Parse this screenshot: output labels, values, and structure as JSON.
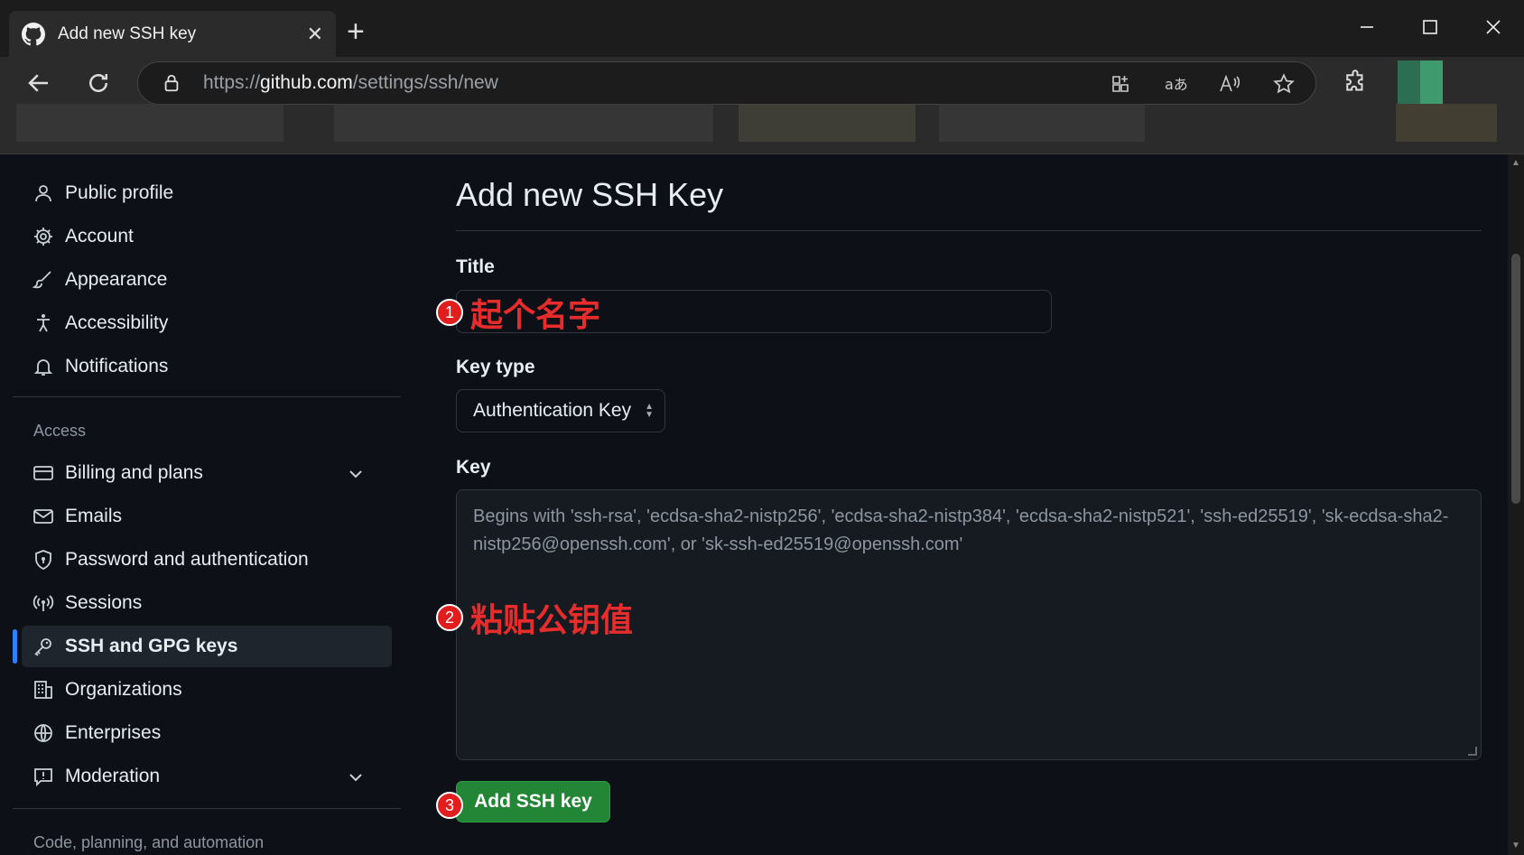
{
  "browser": {
    "tab_title": "Add new SSH key",
    "url_scheme": "https://",
    "url_host": "github.com",
    "url_path": "/settings/ssh/new",
    "new_tab_glyph": "+",
    "close_glyph": "✕"
  },
  "sidebar": {
    "items_top": [
      {
        "label": "Public profile",
        "icon": "person-icon"
      },
      {
        "label": "Account",
        "icon": "gear-icon"
      },
      {
        "label": "Appearance",
        "icon": "paintbrush-icon"
      },
      {
        "label": "Accessibility",
        "icon": "accessibility-icon"
      },
      {
        "label": "Notifications",
        "icon": "bell-icon"
      }
    ],
    "access_label": "Access",
    "items_access": [
      {
        "label": "Billing and plans",
        "icon": "credit-card-icon",
        "expandable": true
      },
      {
        "label": "Emails",
        "icon": "mail-icon"
      },
      {
        "label": "Password and authentication",
        "icon": "shield-lock-icon"
      },
      {
        "label": "Sessions",
        "icon": "broadcast-icon"
      },
      {
        "label": "SSH and GPG keys",
        "icon": "key-icon",
        "active": true
      },
      {
        "label": "Organizations",
        "icon": "organization-icon"
      },
      {
        "label": "Enterprises",
        "icon": "globe-icon"
      },
      {
        "label": "Moderation",
        "icon": "report-icon",
        "expandable": true
      }
    ],
    "code_label": "Code, planning, and automation"
  },
  "main": {
    "page_title": "Add new SSH Key",
    "title_label": "Title",
    "title_value": "",
    "key_type_label": "Key type",
    "key_type_value": "Authentication Key",
    "key_label": "Key",
    "key_placeholder": "Begins with 'ssh-rsa', 'ecdsa-sha2-nistp256', 'ecdsa-sha2-nistp384', 'ecdsa-sha2-nistp521', 'ssh-ed25519', 'sk-ecdsa-sha2-nistp256@openssh.com', or 'sk-ssh-ed25519@openssh.com'",
    "submit_label": "Add SSH key"
  },
  "annotations": [
    {
      "number": "1",
      "text": "起个名字"
    },
    {
      "number": "2",
      "text": "粘贴公钥值"
    },
    {
      "number": "3",
      "text": ""
    }
  ],
  "colors": {
    "accent": "#2f81f7",
    "button_green": "#238636",
    "annotation_red": "#e82c2c"
  }
}
